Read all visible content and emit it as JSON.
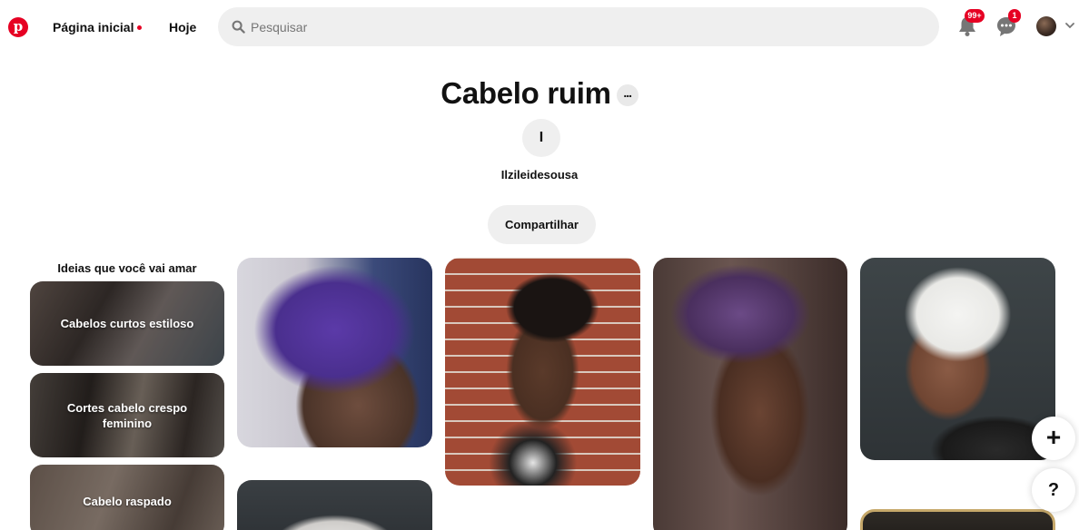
{
  "header": {
    "logo_letter": "p",
    "nav_home": "Página inicial",
    "nav_today": "Hoje",
    "search_placeholder": "Pesquisar",
    "notifications_badge": "99+",
    "messages_badge": "1",
    "brand_color": "#e60023"
  },
  "board": {
    "title": "Cabelo ruim",
    "more_label": "...",
    "owner_initial": "I",
    "owner_name": "Ilzileidesousa",
    "share_label": "Compartilhar"
  },
  "ideas": {
    "title": "Ideias que você vai amar",
    "items": [
      {
        "label": "Cabelos curtos estiloso"
      },
      {
        "label": "Cortes cabelo crespo feminino"
      },
      {
        "label": "Cabelo raspado"
      }
    ]
  },
  "pins": [
    {
      "name": "purple-tapered-afro"
    },
    {
      "name": "white-afro"
    },
    {
      "name": "natural-tapered-cut-brick-wall"
    },
    {
      "name": "purple-curly-undercut"
    },
    {
      "name": "silver-twa-smiling-woman"
    },
    {
      "name": "framed-portrait"
    }
  ],
  "fabs": {
    "add_label": "+",
    "help_label": "?"
  }
}
